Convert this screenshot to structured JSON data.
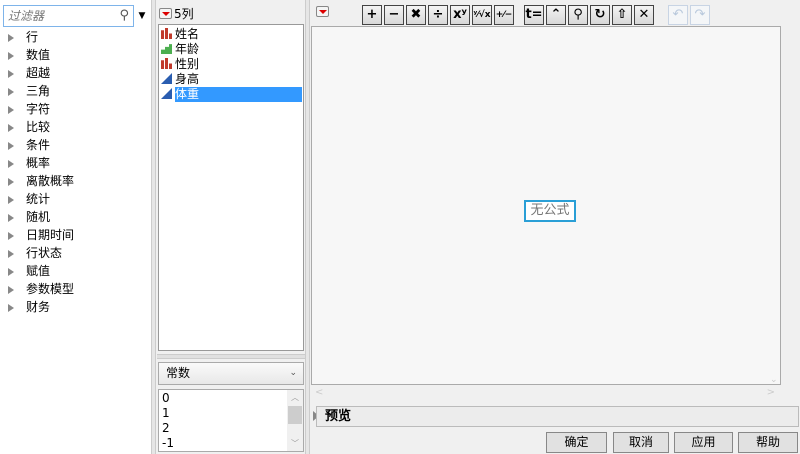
{
  "filter": {
    "placeholder": "过滤器"
  },
  "categories": [
    "行",
    "数值",
    "超越",
    "三角",
    "字符",
    "比较",
    "条件",
    "概率",
    "离散概率",
    "统计",
    "随机",
    "日期时间",
    "行状态",
    "赋值",
    "参数模型",
    "财务"
  ],
  "columns": {
    "header": "5列",
    "items": [
      {
        "name": "姓名",
        "type": "nominal"
      },
      {
        "name": "年龄",
        "type": "ordinal"
      },
      {
        "name": "性别",
        "type": "nominal"
      },
      {
        "name": "身高",
        "type": "continuous"
      },
      {
        "name": "体重",
        "type": "continuous",
        "selected": true
      }
    ]
  },
  "constants": {
    "selected": "常数",
    "values": [
      "0",
      "1",
      "2",
      "-1"
    ]
  },
  "toolbar": [
    "+",
    "−",
    "✖",
    "÷",
    "xʸ",
    "ʸ⁄√x",
    "+⁄−",
    "t=",
    "⌃",
    "⚲",
    "↻",
    "⇧",
    "✕"
  ],
  "undo": "↶",
  "redo": "↷",
  "editor": {
    "placeholder": "无公式"
  },
  "preview": {
    "label": "预览"
  },
  "buttons": {
    "ok": "确定",
    "cancel": "取消",
    "apply": "应用",
    "help": "帮助"
  }
}
